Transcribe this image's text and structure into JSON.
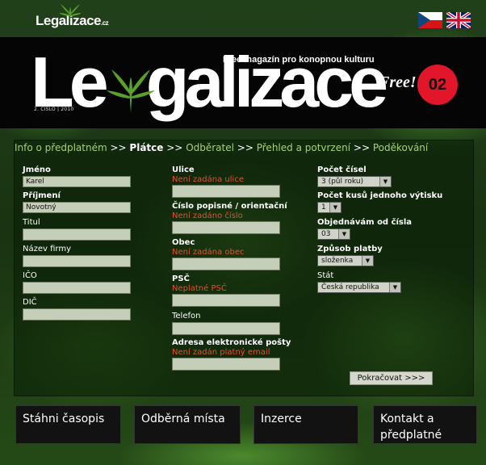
{
  "header": {
    "small_logo_main": "Legal",
    "small_logo_rest": "izace",
    "small_logo_suffix": ".cz",
    "languages": [
      "cz",
      "en"
    ]
  },
  "masthead": {
    "tagline": "Free magazín pro konopnou kulturu",
    "logo_a": "Le",
    "logo_b": "galizace",
    "issue_line": "2. ČÍSLO | 2010",
    "free": "Free!",
    "issue_number": "02",
    "badge_color": "#e2162a"
  },
  "steps": {
    "s1": "Info o předplatném",
    "s2": "Plátce",
    "s3": "Odběratel",
    "s4": "Přehled a potvrzení",
    "s5": "Poděkování",
    "sep": ">>"
  },
  "form": {
    "jmeno": {
      "label": "Jméno",
      "value": "Karel"
    },
    "prijmeni": {
      "label": "Příjmení",
      "value": "Novotný"
    },
    "titul": {
      "label": "Titul",
      "value": ""
    },
    "firma": {
      "label": "Název firmy",
      "value": ""
    },
    "ico": {
      "label": "IČO",
      "value": ""
    },
    "dic": {
      "label": "DIČ",
      "value": ""
    },
    "ulice": {
      "label": "Ulice",
      "error": "Není zadána ulice",
      "value": ""
    },
    "cislo": {
      "label": "Číslo popisné / orientační",
      "error": "Není zadáno číslo",
      "value": ""
    },
    "obec": {
      "label": "Obec",
      "error": "Není zadána obec",
      "value": ""
    },
    "psc": {
      "label": "PSČ",
      "error": "Neplatné PSČ",
      "value": ""
    },
    "telefon": {
      "label": "Telefon",
      "value": ""
    },
    "email": {
      "label": "Adresa elektronické pošty",
      "error": "Není zadán platný email",
      "value": ""
    },
    "pocet_cisel": {
      "label": "Počet čísel",
      "value": "3 (půl roku)"
    },
    "pocet_kusu": {
      "label": "Počet kusů jednoho výtisku",
      "value": "1"
    },
    "od_cisla": {
      "label": "Objednávám od čísla",
      "value": "03"
    },
    "platba": {
      "label": "Způsob platby",
      "value": "složenka"
    },
    "stat": {
      "label": "Stát",
      "value": "Česká republika"
    },
    "continue_label": "Pokračovat >>>"
  },
  "nav": {
    "n1": "Stáhni časopis",
    "n2": "Odběrná místa",
    "n3": "Inzerce",
    "n4_line1": "Kontakt a",
    "n4_line2": "předplatné"
  }
}
